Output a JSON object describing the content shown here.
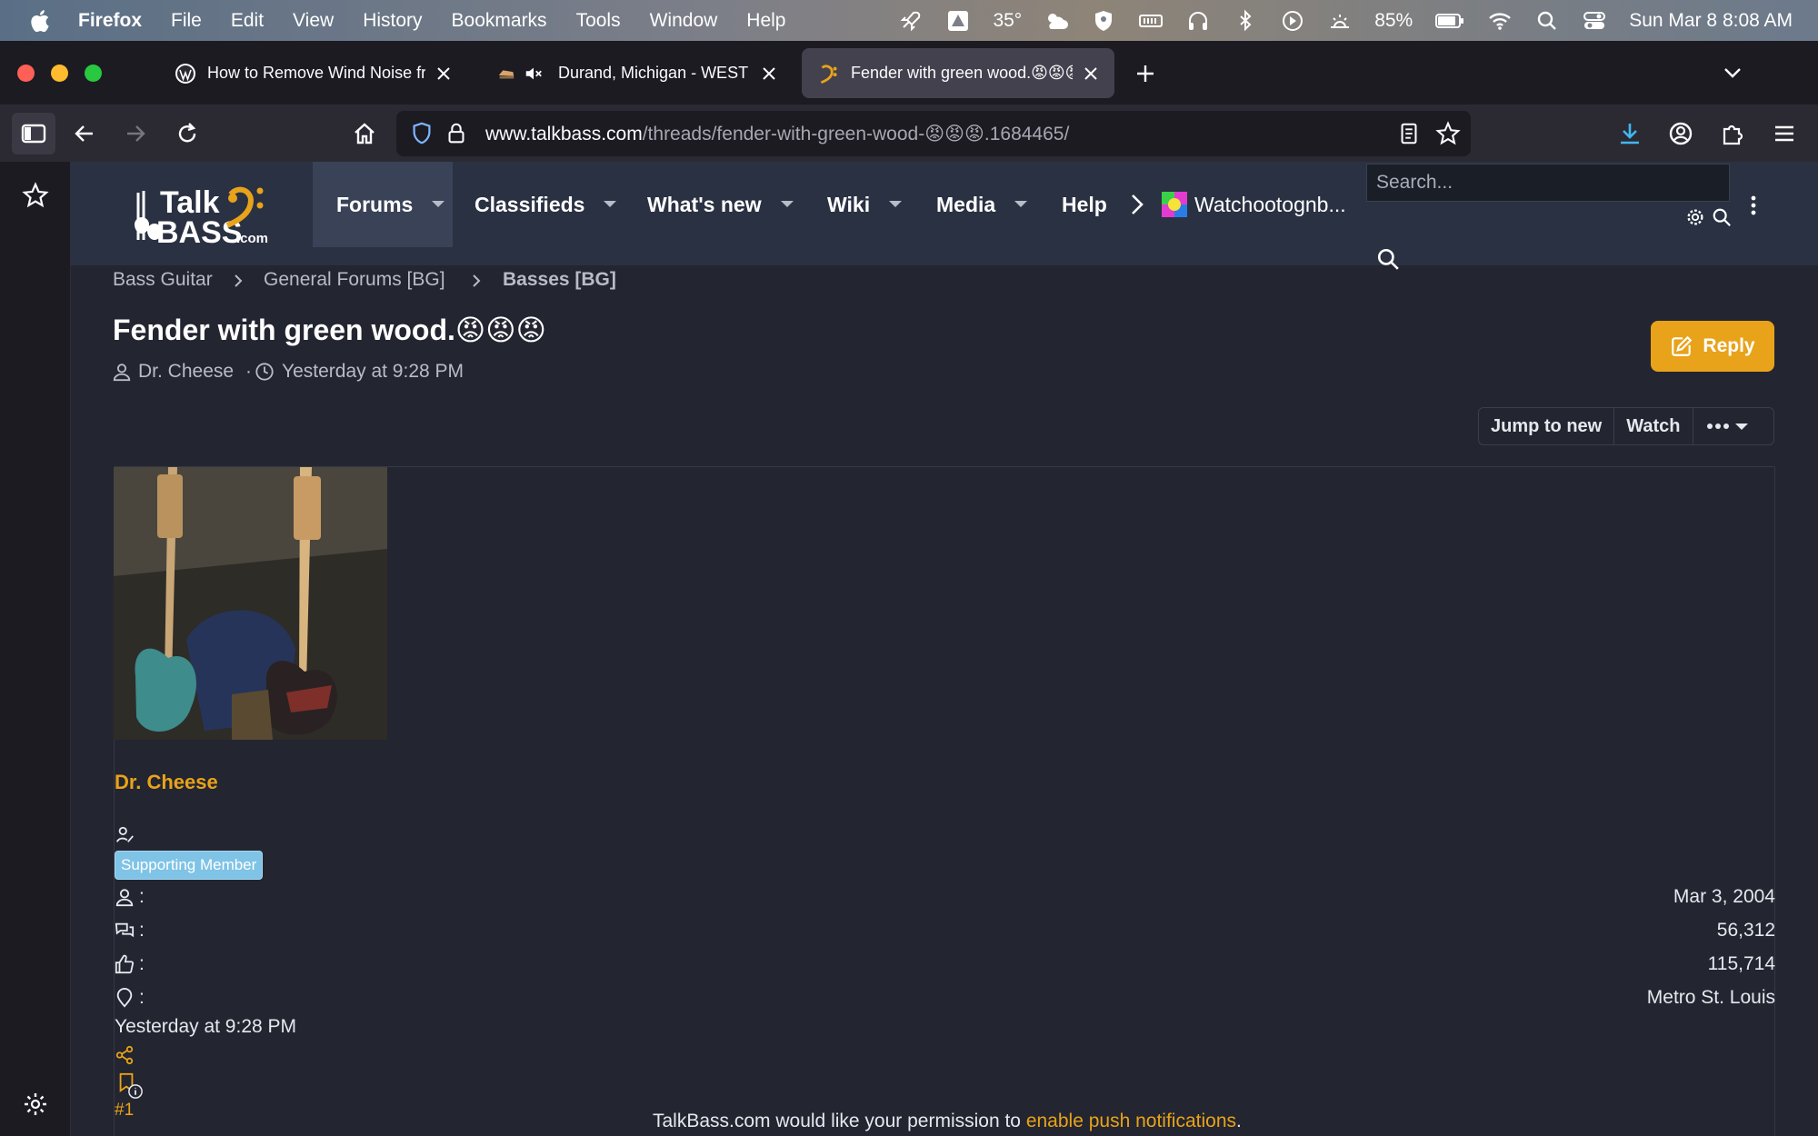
{
  "menubar": {
    "app_name": "Firefox",
    "items": [
      "File",
      "Edit",
      "View",
      "History",
      "Bookmarks",
      "Tools",
      "Window",
      "Help"
    ],
    "weather": "35°",
    "battery": "85%",
    "datetime": "Sun Mar 8  8:08 AM"
  },
  "tabs": [
    {
      "title": "How to Remove Wind Noise from"
    },
    {
      "title": "Durand, Michigan - WEST"
    },
    {
      "title": "Fender with green wood.😡😡😡"
    }
  ],
  "url": {
    "domain": "www.talkbass.com",
    "path": "/threads/fender-with-green-wood-😡😡😡.1684465/"
  },
  "site_nav": {
    "items": [
      "Forums",
      "Classifieds",
      "What's new",
      "Wiki",
      "Media",
      "Help"
    ],
    "user": "Watchootognb...",
    "search_placeholder": "Search..."
  },
  "breadcrumbs": [
    "Bass Guitar",
    "General Forums [BG]",
    "Basses [BG]"
  ],
  "thread": {
    "title": "Fender with green wood.😡😡😡",
    "author": "Dr. Cheese",
    "separator": "·",
    "posted": "Yesterday at 9:28 PM",
    "reply_label": "Reply",
    "jump_label": "Jump to new",
    "watch_label": "Watch"
  },
  "post": {
    "author": "Dr. Cheese",
    "badge": "Supporting Member",
    "joined": "Mar 3, 2004",
    "messages": "56,312",
    "likes": "115,714",
    "location": "Metro St. Louis",
    "stat_colon": ":",
    "date": "Yesterday at 9:28 PM",
    "number": "#1"
  },
  "notice": {
    "text": "TalkBass.com would like your permission to ",
    "link": "enable push notifications",
    "end": "."
  },
  "colors": {
    "accent": "#e8a31a",
    "header_bg": "#2a3142",
    "page_bg": "#232530",
    "badge": "#7fc3e6"
  }
}
